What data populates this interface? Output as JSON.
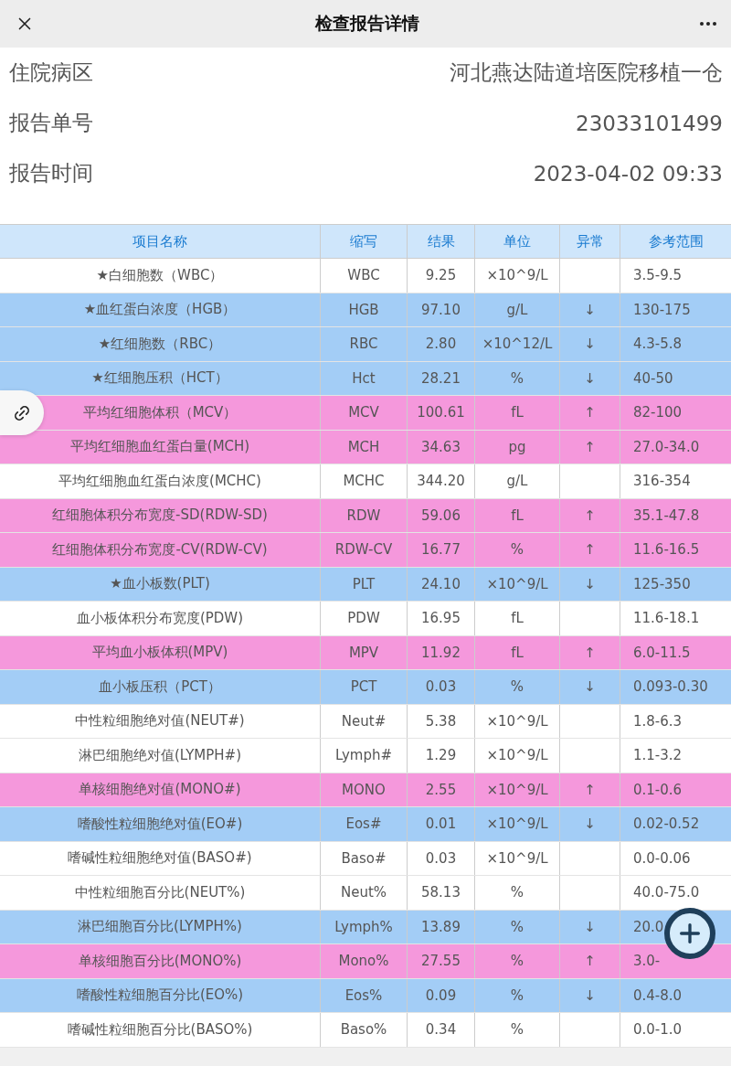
{
  "title": "检查报告详情",
  "info": [
    {
      "label": "住院病区",
      "value": "河北燕达陆道培医院移植一仓"
    },
    {
      "label": "报告单号",
      "value": "23033101499"
    },
    {
      "label": "报告时间",
      "value": "2023-04-02 09:33"
    }
  ],
  "table": {
    "columns": [
      "项目名称",
      "缩写",
      "结果",
      "单位",
      "异常",
      "参考范围"
    ],
    "rows": [
      {
        "color": "#ffffff",
        "cells": [
          "★白细胞数（WBC）",
          "WBC",
          "9.25",
          "×10^9/L",
          "",
          "3.5-9.5"
        ]
      },
      {
        "color": "#a3cdf6",
        "cells": [
          "★血红蛋白浓度（HGB）",
          "HGB",
          "97.10",
          "g/L",
          "↓",
          "130-175"
        ]
      },
      {
        "color": "#a3cdf6",
        "cells": [
          "★红细胞数（RBC）",
          "RBC",
          "2.80",
          "×10^12/L",
          "↓",
          "4.3-5.8"
        ]
      },
      {
        "color": "#a3cdf6",
        "cells": [
          "★红细胞压积（HCT）",
          "Hct",
          "28.21",
          "%",
          "↓",
          "40-50"
        ]
      },
      {
        "color": "#f598dc",
        "cells": [
          "平均红细胞体积（MCV）",
          "MCV",
          "100.61",
          "fL",
          "↑",
          "82-100"
        ]
      },
      {
        "color": "#f598dc",
        "cells": [
          "平均红细胞血红蛋白量(MCH)",
          "MCH",
          "34.63",
          "pg",
          "↑",
          "27.0-34.0"
        ]
      },
      {
        "color": "#ffffff",
        "cells": [
          "平均红细胞血红蛋白浓度(MCHC)",
          "MCHC",
          "344.20",
          "g/L",
          "",
          "316-354"
        ]
      },
      {
        "color": "#f598dc",
        "cells": [
          "红细胞体积分布宽度-SD(RDW-SD)",
          "RDW",
          "59.06",
          "fL",
          "↑",
          "35.1-47.8"
        ]
      },
      {
        "color": "#f598dc",
        "cells": [
          "红细胞体积分布宽度-CV(RDW-CV)",
          "RDW-CV",
          "16.77",
          "%",
          "↑",
          "11.6-16.5"
        ]
      },
      {
        "color": "#a3cdf6",
        "cells": [
          "★血小板数(PLT)",
          "PLT",
          "24.10",
          "×10^9/L",
          "↓",
          "125-350"
        ]
      },
      {
        "color": "#ffffff",
        "cells": [
          "血小板体积分布宽度(PDW)",
          "PDW",
          "16.95",
          "fL",
          "",
          "11.6-18.1"
        ]
      },
      {
        "color": "#f598dc",
        "cells": [
          "平均血小板体积(MPV)",
          "MPV",
          "11.92",
          "fL",
          "↑",
          "6.0-11.5"
        ]
      },
      {
        "color": "#a3cdf6",
        "cells": [
          "血小板压积（PCT）",
          "PCT",
          "0.03",
          "%",
          "↓",
          "0.093-0.30"
        ]
      },
      {
        "color": "#ffffff",
        "cells": [
          "中性粒细胞绝对值(NEUT#)",
          "Neut#",
          "5.38",
          "×10^9/L",
          "",
          "1.8-6.3"
        ]
      },
      {
        "color": "#ffffff",
        "cells": [
          "淋巴细胞绝对值(LYMPH#)",
          "Lymph#",
          "1.29",
          "×10^9/L",
          "",
          "1.1-3.2"
        ]
      },
      {
        "color": "#f598dc",
        "cells": [
          "单核细胞绝对值(MONO#)",
          "MONO",
          "2.55",
          "×10^9/L",
          "↑",
          "0.1-0.6"
        ]
      },
      {
        "color": "#a3cdf6",
        "cells": [
          "嗜酸性粒细胞绝对值(EO#)",
          "Eos#",
          "0.01",
          "×10^9/L",
          "↓",
          "0.02-0.52"
        ]
      },
      {
        "color": "#ffffff",
        "cells": [
          "嗜碱性粒细胞绝对值(BASO#)",
          "Baso#",
          "0.03",
          "×10^9/L",
          "",
          "0.0-0.06"
        ]
      },
      {
        "color": "#ffffff",
        "cells": [
          "中性粒细胞百分比(NEUT%)",
          "Neut%",
          "58.13",
          "%",
          "",
          "40.0-75.0"
        ]
      },
      {
        "color": "#a3cdf6",
        "cells": [
          "淋巴细胞百分比(LYMPH%)",
          "Lymph%",
          "13.89",
          "%",
          "↓",
          "20.0"
        ]
      },
      {
        "color": "#f598dc",
        "cells": [
          "单核细胞百分比(MONO%)",
          "Mono%",
          "27.55",
          "%",
          "↑",
          "3.0-"
        ]
      },
      {
        "color": "#a3cdf6",
        "cells": [
          "嗜酸性粒细胞百分比(EO%)",
          "Eos%",
          "0.09",
          "%",
          "↓",
          "0.4-8.0"
        ]
      },
      {
        "color": "#ffffff",
        "cells": [
          "嗜碱性粒细胞百分比(BASO%)",
          "Baso%",
          "0.34",
          "%",
          "",
          "0.0-1.0"
        ]
      }
    ]
  }
}
